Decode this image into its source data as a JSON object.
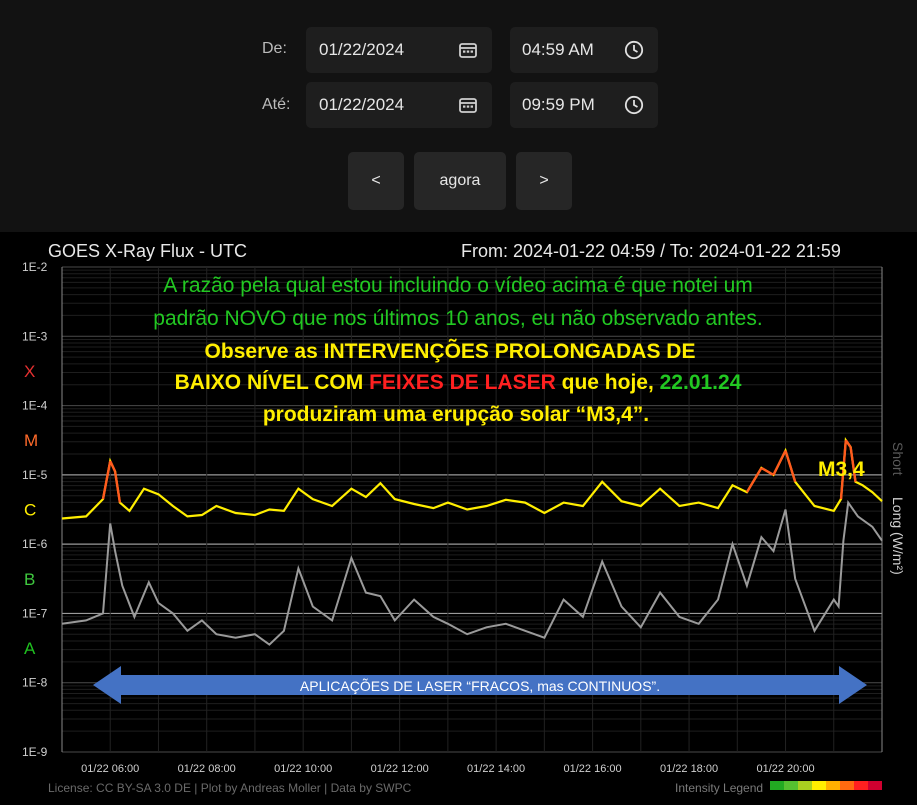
{
  "controls": {
    "from_label": "De:",
    "to_label": "Até:",
    "from_date": "01/22/2024",
    "from_time": "04:59 AM",
    "to_date": "01/22/2024",
    "to_time": "09:59 PM",
    "prev_label": "<",
    "now_label": "agora",
    "next_label": ">"
  },
  "chart_header": {
    "title": "GOES X-Ray Flux - UTC",
    "range": "From: 2024-01-22 04:59  /  To: 2024-01-22 21:59"
  },
  "overlay": {
    "line1": "A razão pela qual estou incluindo o vídeo acima é que notei um",
    "line2": "padrão NOVO que nos últimos 10 anos, eu não observado antes.",
    "line3": "Observe as INTERVENÇÕES PROLONGADAS DE",
    "line4a": "BAIXO NÍVEL COM ",
    "line4b": "FEIXES DE LASER",
    "line4c": " que hoje, ",
    "line4d": "22.01.24",
    "line5": "produziram uma erupção solar “M3,4”.",
    "peak_label": "M3,4",
    "arrow_text": "APLICAÇÕES DE LASER “FRACOS, mas CONTINUOS”."
  },
  "colors": {
    "long_series": "#ffee00",
    "long_high": "#ff5a1e",
    "short_series": "#9a9a9a",
    "overlay_green": "#22c822",
    "overlay_yellow": "#ffee00",
    "overlay_red": "#ff2020",
    "arrow": "#4472c4"
  },
  "footer": {
    "license": "License: CC BY-SA 3.0 DE | Plot by Andreas Moller | Data by SWPC",
    "legend": "Intensity Legend"
  },
  "chart_data": {
    "type": "line",
    "title": "GOES X-Ray Flux - UTC",
    "ylabel": "Long (W/m²)",
    "secondary_label": "Short",
    "y_scale": "log",
    "ylim": [
      1e-09,
      0.01
    ],
    "xlim": [
      5.0,
      22.0
    ],
    "grid": true,
    "y_ticks": [
      "1E-2",
      "1E-3",
      "1E-4",
      "1E-5",
      "1E-6",
      "1E-7",
      "1E-8",
      "1E-9"
    ],
    "y_tick_values": [
      -2,
      -3,
      -4,
      -5,
      -6,
      -7,
      -8,
      -9
    ],
    "flare_classes": [
      {
        "label": "X",
        "exp": -3.5,
        "color": "#e53030"
      },
      {
        "label": "M",
        "exp": -4.5,
        "color": "#ff6a2a"
      },
      {
        "label": "C",
        "exp": -5.5,
        "color": "#ffee00"
      },
      {
        "label": "B",
        "exp": -6.5,
        "color": "#3fc83f"
      },
      {
        "label": "A",
        "exp": -7.5,
        "color": "#1fbf1f"
      }
    ],
    "x_ticks": [
      "01/22 06:00",
      "01/22 08:00",
      "01/22 10:00",
      "01/22 12:00",
      "01/22 14:00",
      "01/22 16:00",
      "01/22 18:00",
      "01/22 20:00"
    ],
    "x_tick_values": [
      6,
      8,
      10,
      12,
      14,
      16,
      18,
      20
    ],
    "series": [
      {
        "name": "Long",
        "x": [
          5.0,
          5.5,
          5.85,
          6.0,
          6.1,
          6.2,
          6.4,
          6.7,
          7.0,
          7.3,
          7.6,
          7.9,
          8.2,
          8.6,
          9.0,
          9.3,
          9.6,
          9.9,
          10.2,
          10.6,
          11.0,
          11.3,
          11.6,
          11.9,
          12.3,
          12.7,
          13.0,
          13.4,
          13.8,
          14.2,
          14.6,
          15.0,
          15.4,
          15.8,
          16.2,
          16.6,
          17.0,
          17.4,
          17.8,
          18.2,
          18.6,
          18.9,
          19.2,
          19.5,
          19.75,
          20.0,
          20.2,
          20.6,
          21.0,
          21.15,
          21.25,
          21.35,
          21.45,
          21.6,
          21.8,
          22.0
        ],
        "values": [
          -5.63,
          -5.6,
          -5.35,
          -4.8,
          -4.95,
          -5.4,
          -5.52,
          -5.2,
          -5.28,
          -5.45,
          -5.6,
          -5.58,
          -5.45,
          -5.55,
          -5.58,
          -5.5,
          -5.52,
          -5.2,
          -5.35,
          -5.45,
          -5.2,
          -5.32,
          -5.12,
          -5.35,
          -5.42,
          -5.48,
          -5.4,
          -5.5,
          -5.45,
          -5.36,
          -5.4,
          -5.55,
          -5.4,
          -5.45,
          -5.1,
          -5.38,
          -5.45,
          -5.2,
          -5.45,
          -5.4,
          -5.48,
          -5.15,
          -5.25,
          -4.9,
          -5.0,
          -4.65,
          -5.1,
          -5.45,
          -5.52,
          -5.35,
          -4.5,
          -4.6,
          -5.1,
          -5.15,
          -5.25,
          -5.38
        ]
      },
      {
        "name": "Short",
        "x": [
          5.0,
          5.5,
          5.85,
          6.0,
          6.1,
          6.25,
          6.5,
          6.8,
          7.0,
          7.3,
          7.6,
          7.9,
          8.2,
          8.6,
          9.0,
          9.3,
          9.6,
          9.9,
          10.2,
          10.6,
          11.0,
          11.3,
          11.6,
          11.9,
          12.3,
          12.7,
          13.0,
          13.4,
          13.8,
          14.2,
          14.6,
          15.0,
          15.4,
          15.8,
          16.2,
          16.6,
          17.0,
          17.4,
          17.8,
          18.2,
          18.6,
          18.9,
          19.2,
          19.5,
          19.75,
          20.0,
          20.2,
          20.6,
          21.0,
          21.1,
          21.2,
          21.3,
          21.5,
          21.8,
          22.0
        ],
        "values": [
          -7.15,
          -7.1,
          -7.0,
          -5.7,
          -6.1,
          -6.6,
          -7.05,
          -6.55,
          -6.85,
          -7.0,
          -7.25,
          -7.1,
          -7.3,
          -7.35,
          -7.3,
          -7.45,
          -7.25,
          -6.35,
          -6.9,
          -7.1,
          -6.2,
          -6.7,
          -6.75,
          -7.1,
          -6.8,
          -7.05,
          -7.15,
          -7.3,
          -7.2,
          -7.15,
          -7.25,
          -7.35,
          -6.8,
          -7.05,
          -6.25,
          -6.9,
          -7.2,
          -6.7,
          -7.05,
          -7.15,
          -6.8,
          -6.0,
          -6.6,
          -5.9,
          -6.1,
          -5.5,
          -6.5,
          -7.25,
          -6.8,
          -6.9,
          -5.95,
          -5.4,
          -5.6,
          -5.75,
          -5.95
        ]
      }
    ]
  }
}
